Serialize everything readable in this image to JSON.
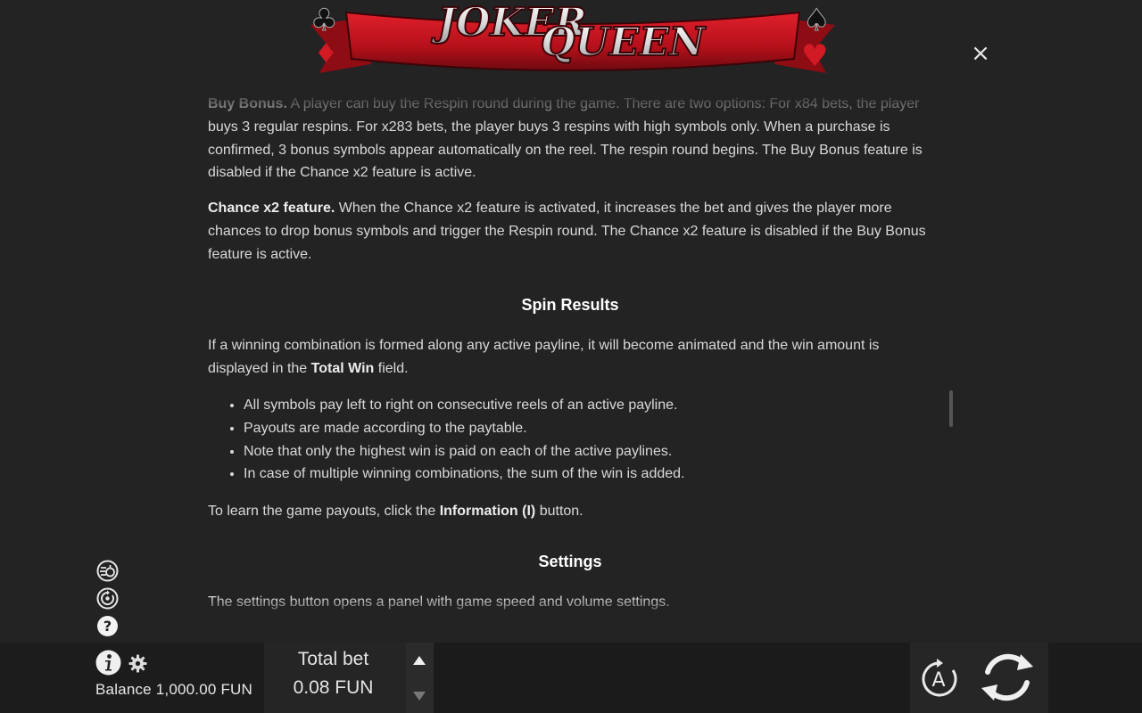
{
  "logo": {
    "line1": "JOKER",
    "line2": "QUEEN"
  },
  "close_label": "×",
  "rules": {
    "buy_bonus_title": "Buy Bonus.",
    "buy_bonus_text": " A player can buy the Respin round during the game. There are two options: For x84 bets, the player buys 3 regular respins. For x283 bets, the player buys 3 respins with high symbols only. When a purchase is confirmed, 3 bonus symbols appear automatically on the reel. The respin round begins. The Buy Bonus feature is disabled if the Chance x2 feature is active.",
    "chance_title": "Chance x2 feature.",
    "chance_text": " When the Chance x2 feature is activated, it increases the bet and gives the player more chances to drop bonus symbols and trigger the Respin round. The Chance x2 feature is disabled if the Buy Bonus feature is active.",
    "spin_results_heading": "Spin Results",
    "spin_results_text_1": "If a winning combination is formed along any active payline, it will become animated and the win amount is displayed in the ",
    "spin_results_bold": "Total Win",
    "spin_results_text_2": " field.",
    "bullets": [
      "All symbols pay left to right on consecutive reels of an active payline.",
      "Payouts are made according to the paytable.",
      "Note that only the highest win is paid on each of the active paylines.",
      "In case of multiple winning combinations, the sum of the win is added."
    ],
    "payouts_text_1": "To learn the game payouts, click the ",
    "payouts_bold": "Information (I)",
    "payouts_text_2": " button.",
    "settings_heading": "Settings",
    "settings_text": "The settings button opens a panel with game speed and volume settings."
  },
  "side_icons": [
    "buy-bonus-icon",
    "history-icon",
    "help-icon"
  ],
  "bottom_bar": {
    "balance": "Balance 1,000.00 FUN",
    "total_bet_label": "Total bet",
    "total_bet_value": "0.08 FUN",
    "autoplay_label": "A"
  },
  "colors": {
    "background": "#232323",
    "banner_red": "#c0141e",
    "text": "#d9d9d9",
    "heading": "#ffffff"
  }
}
